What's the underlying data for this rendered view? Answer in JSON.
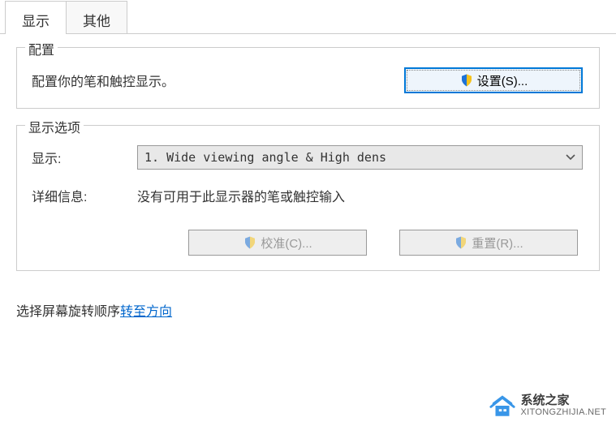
{
  "tabs": {
    "display": "显示",
    "other": "其他"
  },
  "group_config": {
    "title": "配置",
    "description": "配置你的笔和触控显示。",
    "settings_button": "设置(S)..."
  },
  "group_display_options": {
    "title": "显示选项",
    "display_label": "显示:",
    "display_value": "1. Wide viewing angle & High dens",
    "detail_label": "详细信息:",
    "detail_value": "没有可用于此显示器的笔或触控输入",
    "calibrate_button": "校准(C)...",
    "reset_button": "重置(R)..."
  },
  "rotation": {
    "prefix": "选择屏幕旋转顺序",
    "link": "转至方向"
  },
  "watermark": {
    "title": "系统之家",
    "subtitle": "XITONGZHIJIA.NET"
  }
}
